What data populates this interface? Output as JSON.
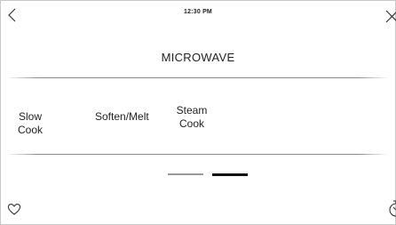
{
  "status_bar": {
    "time": "12:30 PM"
  },
  "header": {
    "title": "MICROWAVE",
    "back_icon": "chevron-left-icon",
    "close_icon": "close-icon"
  },
  "options": [
    {
      "label": "Slow Cook"
    },
    {
      "label": "Soften/Melt"
    },
    {
      "label_line1": "Steam",
      "label_line2": "Cook"
    }
  ],
  "pager": {
    "current_page": 2,
    "total_pages": 2
  },
  "footer": {
    "favorite_icon": "heart-icon",
    "timer_icon": "timer-icon"
  },
  "colors": {
    "background": "#ffffff",
    "text": "#222222",
    "divider": "#8a8a8a",
    "pager_active": "#111111",
    "pager_inactive": "#9a9a9a"
  }
}
